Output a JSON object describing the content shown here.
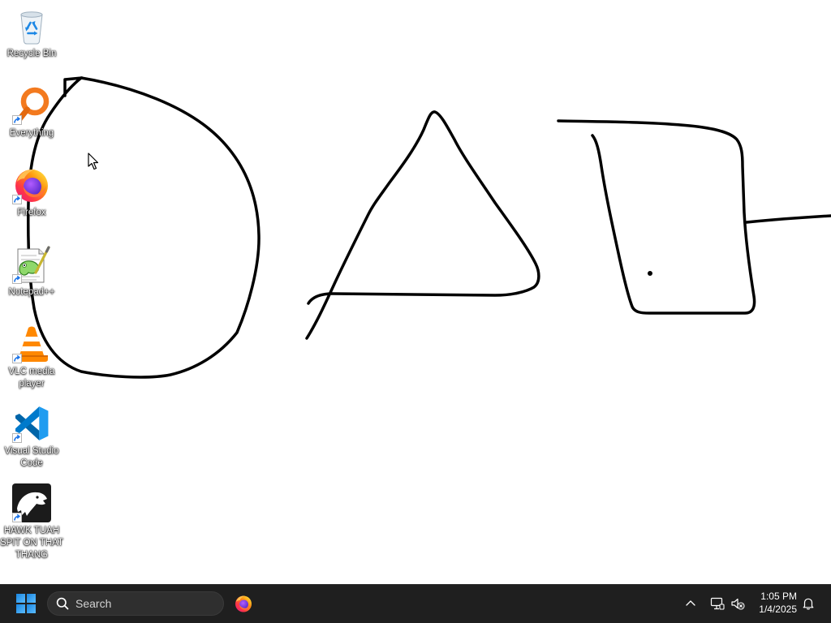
{
  "desktop": {
    "background_color": "#ffffff",
    "drawing_color": "#000000",
    "icons": [
      {
        "label": "Recycle Bin",
        "icon": "recycle-bin-icon",
        "shortcut": false
      },
      {
        "label": "Everything",
        "icon": "magnifier-icon",
        "shortcut": true
      },
      {
        "label": "Firefox",
        "icon": "firefox-icon",
        "shortcut": true
      },
      {
        "label": "Notepad++",
        "icon": "notepad-plus-plus-icon",
        "shortcut": true
      },
      {
        "label": "VLC media player",
        "icon": "vlc-cone-icon",
        "shortcut": true
      },
      {
        "label": "Visual Studio Code",
        "icon": "vscode-icon",
        "shortcut": true
      },
      {
        "label": "HAWK TUAH SPIT ON THAT THANG",
        "icon": "eagle-icon",
        "shortcut": true
      }
    ]
  },
  "taskbar": {
    "background_color": "#1f1f1f",
    "start_icon": "windows-logo-icon",
    "search": {
      "icon": "search-icon",
      "label": "Search"
    },
    "pinned_apps": [
      {
        "icon": "firefox-icon"
      }
    ],
    "tray": {
      "overflow_icon": "chevron-up-icon",
      "network_icon": "ethernet-icon",
      "volume_icon": "volume-muted-icon",
      "time": "1:05 PM",
      "date": "1/4/2025",
      "notification_icon": "bell-icon"
    }
  },
  "accent_color": "#0078d4"
}
